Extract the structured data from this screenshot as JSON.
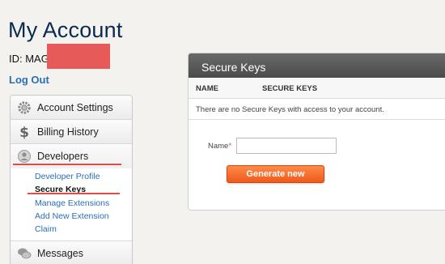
{
  "page": {
    "title": "My Account",
    "id_label": "ID: MAG",
    "logout": "Log Out"
  },
  "nav": {
    "account_settings": "Account Settings",
    "billing_history": "Billing History",
    "developers": "Developers",
    "developer_sub": [
      "Developer Profile",
      "Secure Keys",
      "Manage Extensions",
      "Add New Extension",
      "Claim"
    ],
    "messages": "Messages"
  },
  "panel": {
    "title": "Secure Keys",
    "col_name": "NAME",
    "col_keys": "SECURE KEYS",
    "empty_message": "There are no Secure Keys with access to your account.",
    "name_label": "Name",
    "required_mark": "*",
    "name_value": "",
    "generate_button": "Generate new"
  },
  "colors": {
    "title": "#0a2a52",
    "link": "#2a6fb4",
    "annotation": "#e34b4b",
    "button": "#f06a2a",
    "redaction": "#e65a5a"
  }
}
